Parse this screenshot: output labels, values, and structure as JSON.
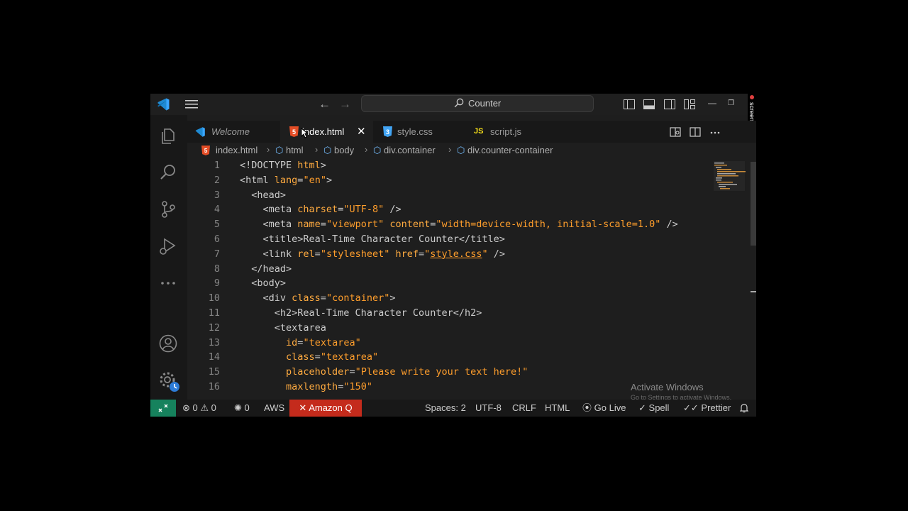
{
  "titlebar": {
    "search_text": "Counter",
    "recorder_label": "screenrec"
  },
  "tabs": [
    {
      "label": "Welcome",
      "icon": "vscode-logo-icon"
    },
    {
      "label": "index.html",
      "icon": "html5-icon",
      "active": true
    },
    {
      "label": "style.css",
      "icon": "css3-icon"
    },
    {
      "label": "script.js",
      "icon": "js-icon",
      "icon_text": "JS"
    }
  ],
  "breadcrumbs": [
    "index.html",
    "html",
    "body",
    "div.container",
    "div.counter-container"
  ],
  "editor": {
    "lines": [
      {
        "n": "1",
        "parts": [
          [
            "t",
            "<!DOCTYPE "
          ],
          [
            "a",
            "html"
          ],
          [
            "t",
            ">"
          ]
        ]
      },
      {
        "n": "2",
        "parts": [
          [
            "t",
            "<html "
          ],
          [
            "a",
            "lang"
          ],
          [
            "t",
            "="
          ],
          [
            "s",
            "\"en\""
          ],
          [
            "t",
            ">"
          ]
        ]
      },
      {
        "n": "3",
        "parts": [
          [
            "t",
            "  <head>"
          ]
        ]
      },
      {
        "n": "4",
        "parts": [
          [
            "t",
            "    <meta "
          ],
          [
            "a",
            "charset"
          ],
          [
            "t",
            "="
          ],
          [
            "s",
            "\"UTF-8\""
          ],
          [
            "t",
            " />"
          ]
        ]
      },
      {
        "n": "5",
        "parts": [
          [
            "t",
            "    <meta "
          ],
          [
            "a",
            "name"
          ],
          [
            "t",
            "="
          ],
          [
            "s",
            "\"viewport\""
          ],
          [
            "t",
            " "
          ],
          [
            "a",
            "content"
          ],
          [
            "t",
            "="
          ],
          [
            "s",
            "\"width=device-width, initial-scale=1.0\""
          ],
          [
            "t",
            " />"
          ]
        ]
      },
      {
        "n": "6",
        "parts": [
          [
            "t",
            "    <title>"
          ],
          [
            "e",
            "Real-Time Character Counter"
          ],
          [
            "t",
            "</title>"
          ]
        ]
      },
      {
        "n": "7",
        "parts": [
          [
            "t",
            "    <link "
          ],
          [
            "a",
            "rel"
          ],
          [
            "t",
            "="
          ],
          [
            "s",
            "\"stylesheet\""
          ],
          [
            "t",
            " "
          ],
          [
            "a",
            "href"
          ],
          [
            "t",
            "="
          ],
          [
            "s",
            "\""
          ],
          [
            "u",
            "style.css"
          ],
          [
            "s",
            "\""
          ],
          [
            "t",
            " />"
          ]
        ]
      },
      {
        "n": "8",
        "parts": [
          [
            "t",
            "  </head>"
          ]
        ]
      },
      {
        "n": "9",
        "parts": [
          [
            "t",
            "  <body>"
          ]
        ]
      },
      {
        "n": "10",
        "parts": [
          [
            "t",
            "    <div "
          ],
          [
            "a",
            "class"
          ],
          [
            "t",
            "="
          ],
          [
            "s",
            "\"container\""
          ],
          [
            "t",
            ">"
          ]
        ]
      },
      {
        "n": "11",
        "parts": [
          [
            "t",
            "      <h2>"
          ],
          [
            "e",
            "Real-Time Character Counter"
          ],
          [
            "t",
            "</h2>"
          ]
        ]
      },
      {
        "n": "12",
        "parts": [
          [
            "t",
            "      <textarea"
          ]
        ]
      },
      {
        "n": "13",
        "parts": [
          [
            "t",
            "        "
          ],
          [
            "a",
            "id"
          ],
          [
            "t",
            "="
          ],
          [
            "s",
            "\"textarea\""
          ]
        ]
      },
      {
        "n": "14",
        "parts": [
          [
            "t",
            "        "
          ],
          [
            "a",
            "class"
          ],
          [
            "t",
            "="
          ],
          [
            "s",
            "\"textarea\""
          ]
        ]
      },
      {
        "n": "15",
        "parts": [
          [
            "t",
            "        "
          ],
          [
            "a",
            "placeholder"
          ],
          [
            "t",
            "="
          ],
          [
            "s",
            "\"Please write your text here!\""
          ]
        ]
      },
      {
        "n": "16",
        "parts": [
          [
            "t",
            "        "
          ],
          [
            "a",
            "maxlength"
          ],
          [
            "t",
            "="
          ],
          [
            "s",
            "\"150\""
          ]
        ]
      }
    ]
  },
  "watermark": {
    "title": "Activate Windows",
    "subtitle": "Go to Settings to activate Windows."
  },
  "status": {
    "errors": "0",
    "warnings": "0",
    "ports": "0",
    "aws": "AWS",
    "amazon_q": "Amazon Q",
    "spaces": "Spaces: 2",
    "encoding": "UTF-8",
    "eol": "CRLF",
    "language": "HTML",
    "go_live": "Go Live",
    "spell": "Spell",
    "prettier": "Prettier"
  },
  "colors": {
    "accent": "#16825d",
    "amazon_q": "#c42b1c",
    "string": "#ff9e2c",
    "attribute": "#ffab40",
    "vscode_blue": "#3ba7ff",
    "html_orange": "#e44d26",
    "css_blue": "#42a5f5",
    "js_yellow": "#f5de19"
  }
}
